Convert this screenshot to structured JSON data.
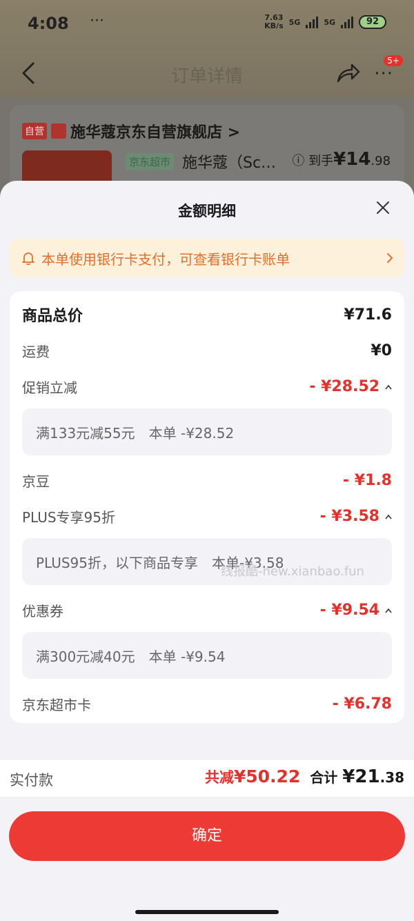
{
  "status_bar": {
    "time": "4:08",
    "dots": "···",
    "net_speed_value": "7.63",
    "net_speed_unit": "KB/s",
    "signal_1": "5G",
    "signal_2": "5G",
    "battery": "92"
  },
  "nav": {
    "title": "订单详情",
    "more": "···",
    "badge": "5+"
  },
  "shop": {
    "self_tag": "自营",
    "name": "施华蔻京东自营旗舰店 >",
    "product_tag": "京东超市",
    "product_title": "施华蔻（Sc…",
    "price_prefix": "到手",
    "price_int": "¥14",
    "price_dec": ".98"
  },
  "sheet": {
    "title": "金额明细",
    "bank_notice": "本单使用银行卡支付，可查看银行卡账单",
    "rows": {
      "subtotal": {
        "label": "商品总价",
        "value": "¥71.6"
      },
      "shipping": {
        "label": "运费",
        "value": "¥0"
      },
      "promo": {
        "label": "促销立减",
        "value": "- ¥28.52",
        "detail": "满133元减55元　本单 -¥28.52"
      },
      "jingdou": {
        "label": "京豆",
        "value": "- ¥1.8"
      },
      "plus": {
        "label": "PLUS专享95折",
        "value": "- ¥3.58",
        "detail": "PLUS95折，以下商品专享　本单-¥3.58"
      },
      "coupon": {
        "label": "优惠券",
        "value": "- ¥9.54",
        "detail": "满300元减40元　本单 -¥9.54"
      },
      "card": {
        "label": "京东超市卡",
        "value": "- ¥6.78"
      }
    },
    "watermark": "线报酷-new.xianbao.fun"
  },
  "payment": {
    "label": "实付款",
    "saved_prefix": "共减",
    "saved_value": "¥50.22",
    "total_prefix": "合计",
    "total_int": "¥21",
    "total_dec": ".38"
  },
  "confirm_label": "确定",
  "colors": {
    "accent_red": "#e4312c",
    "button_red": "#ee3a34",
    "notice_bg": "#fdf1dc",
    "notice_text": "#e2702a"
  }
}
